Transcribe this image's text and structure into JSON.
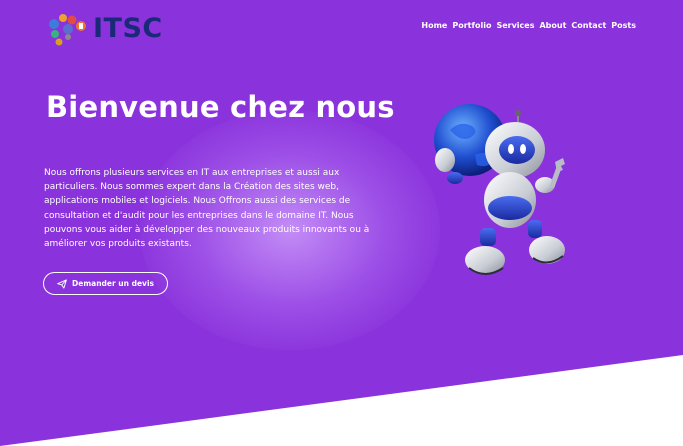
{
  "brand": {
    "name": "ITSC"
  },
  "nav": {
    "items": [
      "Home",
      "Portfolio",
      "Services",
      "About",
      "Contact",
      "Posts"
    ]
  },
  "hero": {
    "title": "Bienvenue chez nous",
    "description": "Nous offrons plusieurs services en IT aux entreprises et aussi aux particuliers. Nous sommes expert dans la Création des sites web, applications mobiles et logiciels. Nous Offrons aussi des services de consultation et d'audit pour les entreprises dans le domaine IT. Nous pouvons vous aider à développer des nouveaux produits innovants ou à  améliorer vos produits existants.",
    "cta_label": "Demander un devis",
    "cta_icon": "paper-plane-icon",
    "illustration": "robot-with-globe"
  },
  "colors": {
    "hero_bg": "#8a33dc",
    "brand_text": "#1b2a78",
    "footer_bg": "#ffffff"
  }
}
